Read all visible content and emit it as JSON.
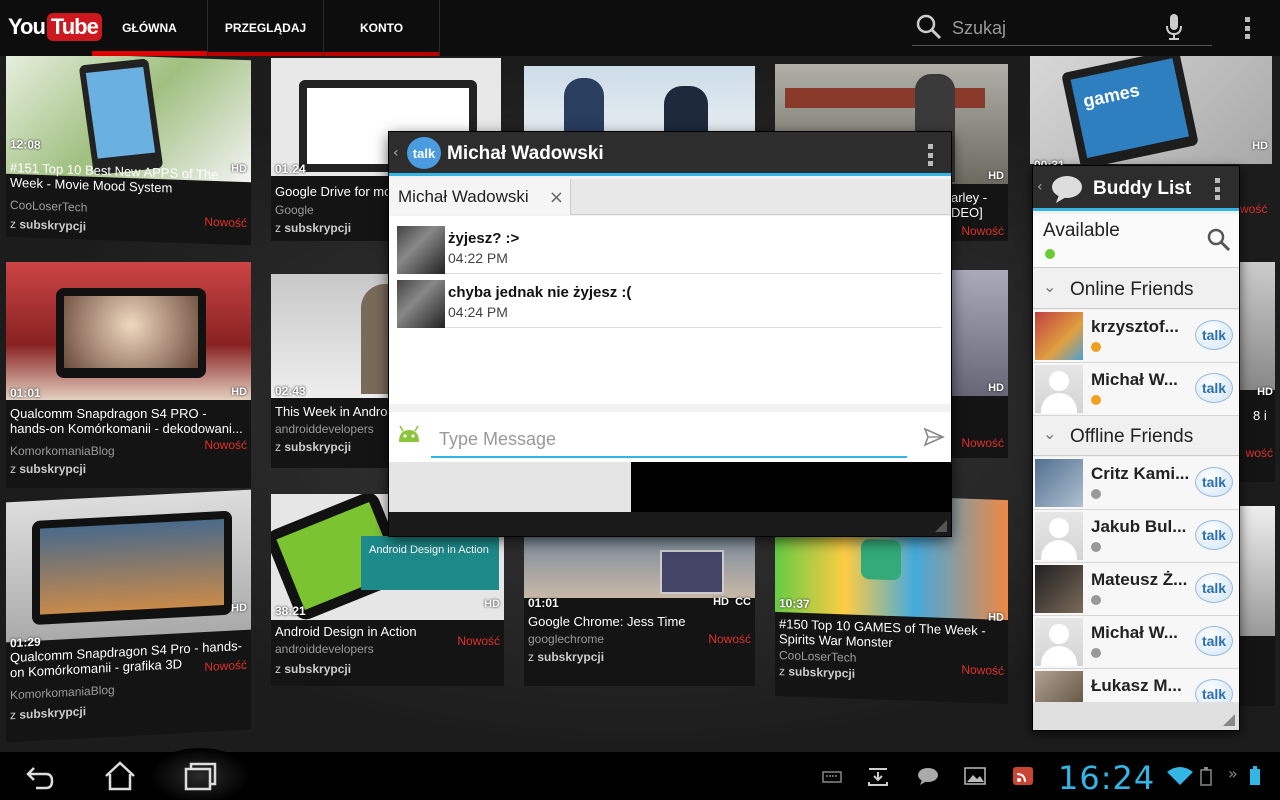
{
  "app": {
    "logo_you": "You",
    "logo_tube": "Tube",
    "tabs": [
      "GŁÓWNA",
      "PRZEGLĄDAJ",
      "KONTO"
    ],
    "search_placeholder": "Szukaj"
  },
  "videos": [
    {
      "duration": "12:08",
      "hd": "HD",
      "title": "#151 Top 10 Best New APPS of The Week - Movie Mood System",
      "channel": "CooLoserTech",
      "sub_prefix": "z",
      "sub_label": "subskrypcji",
      "new": "Nowość"
    },
    {
      "duration": "01:24",
      "hd": "",
      "title": "Google Drive for mo",
      "channel": "Google",
      "sub_prefix": "z",
      "sub_label": "subskrypcji",
      "new": ""
    },
    {
      "duration": "",
      "hd": "HD",
      "title": "arley - DEO]",
      "channel": "",
      "sub_prefix": "",
      "sub_label": "",
      "new": "Nowość"
    },
    {
      "duration": "00:31",
      "hd": "HD",
      "title": "",
      "channel": "",
      "sub_prefix": "",
      "sub_label": "",
      "new": "wość"
    },
    {
      "duration": "01:01",
      "hd": "HD",
      "title": "Qualcomm Snapdragon S4 PRO - hands-on Komórkomanii - dekodowani...",
      "channel": "KomorkomaniaBlog",
      "sub_prefix": "z",
      "sub_label": "subskrypcji",
      "new": "Nowość"
    },
    {
      "duration": "02:43",
      "hd": "",
      "title": "This Week in Androi",
      "channel": "androiddevelopers",
      "sub_prefix": "z",
      "sub_label": "subskrypcji",
      "new": ""
    },
    {
      "duration": "",
      "hd": "HD",
      "title": "",
      "channel": "",
      "sub_prefix": "",
      "sub_label": "",
      "new": "Nowość"
    },
    {
      "duration": "",
      "hd": "HD",
      "title": "8 i",
      "channel": "",
      "sub_prefix": "",
      "sub_label": "",
      "new": "wość"
    },
    {
      "duration": "01:29",
      "hd": "HD",
      "title": "Qualcomm Snapdragon S4 Pro - hands-on Komórkomanii - grafika 3D",
      "channel": "KomorkomaniaBlog",
      "sub_prefix": "z",
      "sub_label": "subskrypcji",
      "new": "Nowość"
    },
    {
      "duration": "38:21",
      "hd": "HD",
      "title": "Android Design in Action",
      "channel": "androiddevelopers",
      "sub_prefix": "z",
      "sub_label": "subskrypcji",
      "new": "Nowość"
    },
    {
      "duration": "01:01",
      "hd": "HD",
      "cc": "CC",
      "title": "Google Chrome: Jess Time",
      "channel": "googlechrome",
      "sub_prefix": "z",
      "sub_label": "subskrypcji",
      "new": "Nowość"
    },
    {
      "duration": "10:37",
      "hd": "HD",
      "title": "#150 Top 10 GAMES of The Week - Spirits War Monster",
      "channel": "CooLoserTech",
      "sub_prefix": "z",
      "sub_label": "subskrypcji",
      "new": "Nowość"
    }
  ],
  "thumb_text": {
    "android_design": "Android Design in Action",
    "games": "games"
  },
  "chat": {
    "title": "Michał Wadowski",
    "tab_label": "Michał Wadowski",
    "talk_label": "talk",
    "messages": [
      {
        "text": "żyjesz? :>",
        "time": "04:22 PM"
      },
      {
        "text": "chyba jednak nie żyjesz :(",
        "time": "04:24 PM"
      }
    ],
    "input_placeholder": "Type Message"
  },
  "buddy": {
    "title": "Buddy List",
    "status": "Available",
    "online_header": "Online Friends",
    "offline_header": "Offline Friends",
    "talk_label": "talk",
    "online": [
      {
        "name": "krzysztof...",
        "status": "away"
      },
      {
        "name": "Michał W...",
        "status": "away"
      }
    ],
    "offline": [
      {
        "name": "Critz Kami...",
        "status": "off"
      },
      {
        "name": "Jakub Bul...",
        "status": "off"
      },
      {
        "name": "Mateusz Ż...",
        "status": "off"
      },
      {
        "name": "Michał W...",
        "status": "off"
      },
      {
        "name": "Łukasz M...",
        "status": "off"
      }
    ]
  },
  "system": {
    "clock": "16:24"
  },
  "colors": {
    "accent": "#33b5e5",
    "youtube_red": "#cc181e",
    "new_label": "#e0302a"
  }
}
